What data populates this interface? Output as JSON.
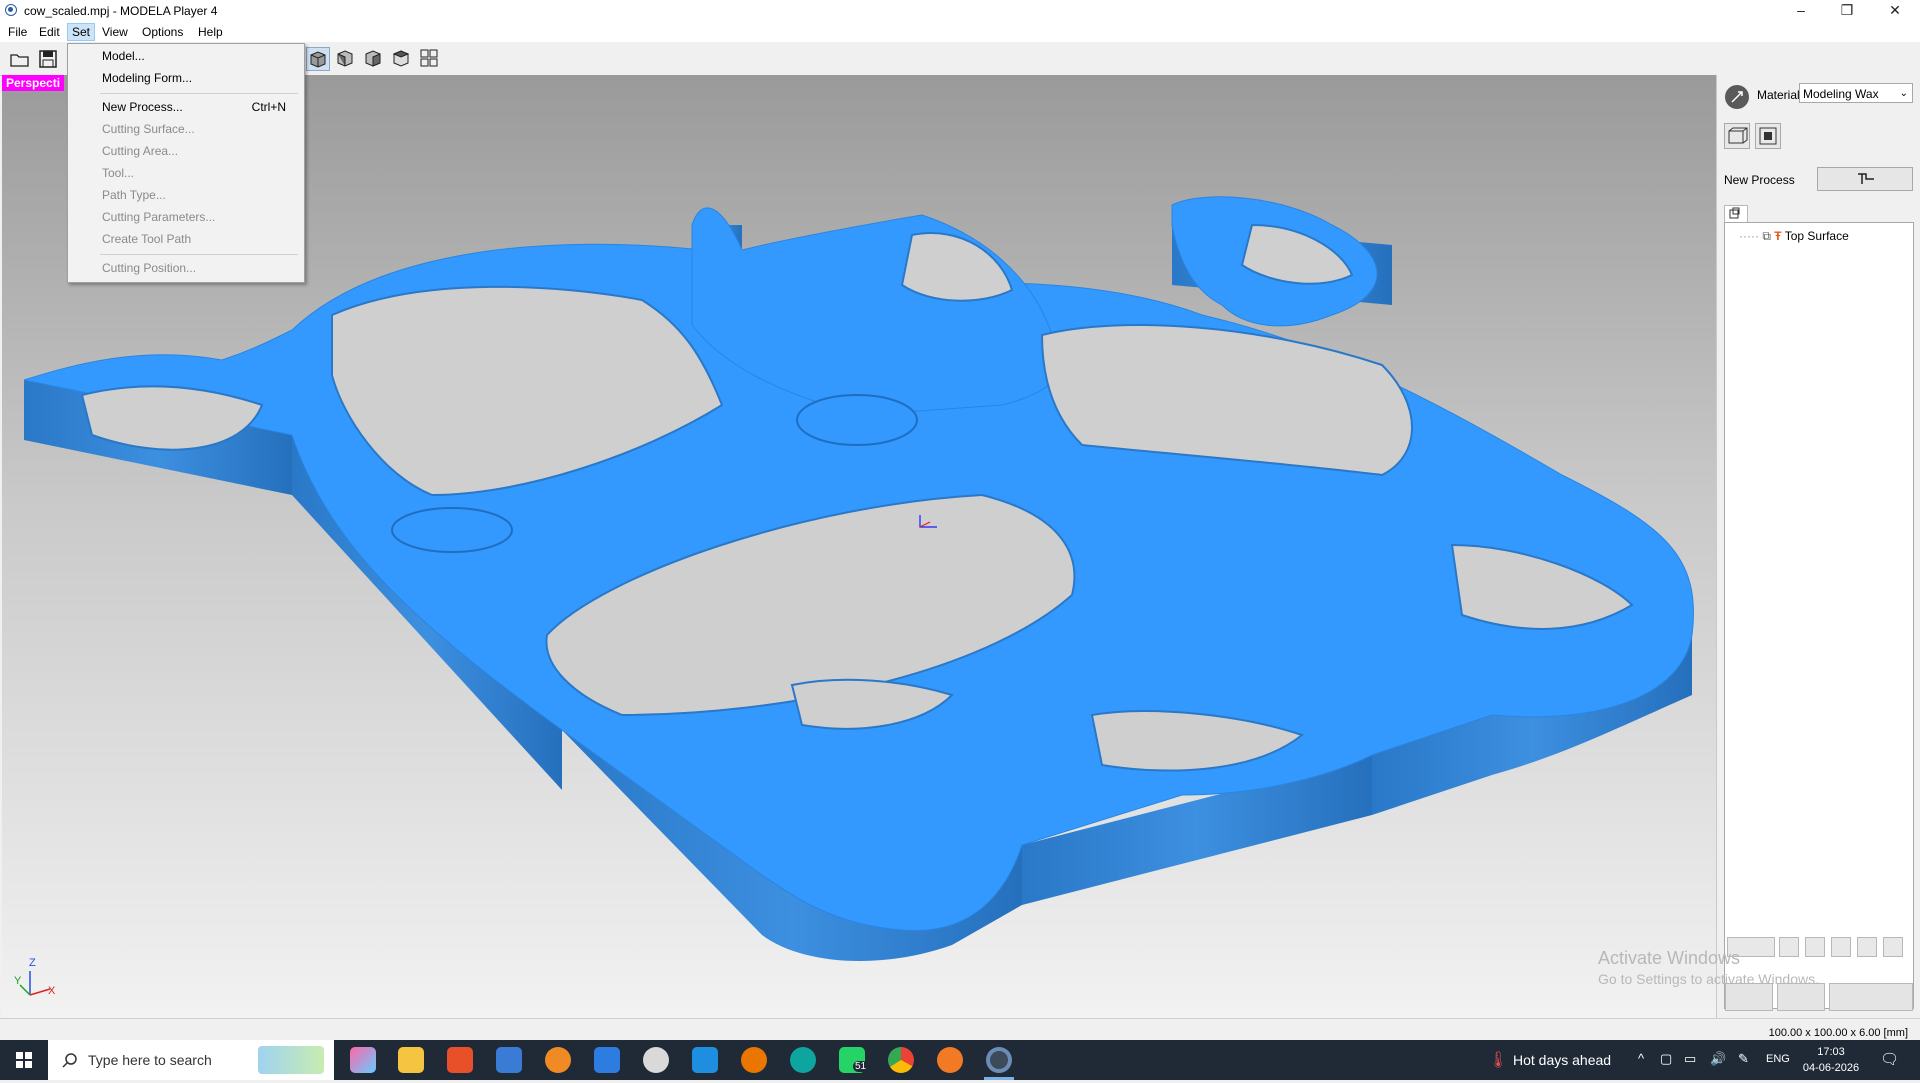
{
  "window": {
    "title": "cow_scaled.mpj - MODELA Player 4",
    "controls": {
      "minimize": "–",
      "maximize": "❐",
      "close": "✕"
    }
  },
  "menubar": {
    "items": [
      {
        "id": "file",
        "label": "File"
      },
      {
        "id": "edit",
        "label": "Edit"
      },
      {
        "id": "set",
        "label": "Set",
        "active": true
      },
      {
        "id": "view",
        "label": "View"
      },
      {
        "id": "options",
        "label": "Options"
      },
      {
        "id": "help",
        "label": "Help"
      }
    ]
  },
  "toolbar": {
    "icons": [
      "open-folder-icon",
      "save-icon",
      "iso-view-icon",
      "front-view-icon",
      "side-view-icon",
      "top-view-icon",
      "quad-view-icon"
    ]
  },
  "set_menu": {
    "items": [
      {
        "label": "Model...",
        "enabled": true
      },
      {
        "label": "Modeling Form...",
        "enabled": true
      },
      {
        "label": "New Process...",
        "shortcut": "Ctrl+N",
        "enabled": true
      },
      {
        "label": "Cutting Surface...",
        "enabled": false
      },
      {
        "label": "Cutting Area...",
        "enabled": false
      },
      {
        "label": "Tool...",
        "enabled": false
      },
      {
        "label": "Path Type...",
        "enabled": false
      },
      {
        "label": "Cutting Parameters...",
        "enabled": false
      },
      {
        "label": "Create Tool Path",
        "enabled": false
      },
      {
        "label": "Cutting Position...",
        "enabled": false
      }
    ]
  },
  "viewport": {
    "view_label": "Perspecti",
    "model_color": "#3399ff",
    "gizmo": {
      "z": "Z",
      "y": "Y",
      "x": "X"
    }
  },
  "right_panel": {
    "material_label": "Material",
    "material_value": "Modeling Wax",
    "new_process_label": "New Process",
    "tree": {
      "item_label": "Top Surface"
    }
  },
  "watermark": {
    "line1": "Activate Windows",
    "line2": "Go to Settings to activate Windows."
  },
  "statusbar": {
    "dimensions": "100.00 x 100.00 x 6.00 [mm]"
  },
  "taskbar": {
    "search_placeholder": "Type here to search",
    "whatsapp_badge": "51",
    "weather": "Hot days ahead",
    "language": "ENG",
    "time": "17:03",
    "date": "04-06-2026"
  }
}
